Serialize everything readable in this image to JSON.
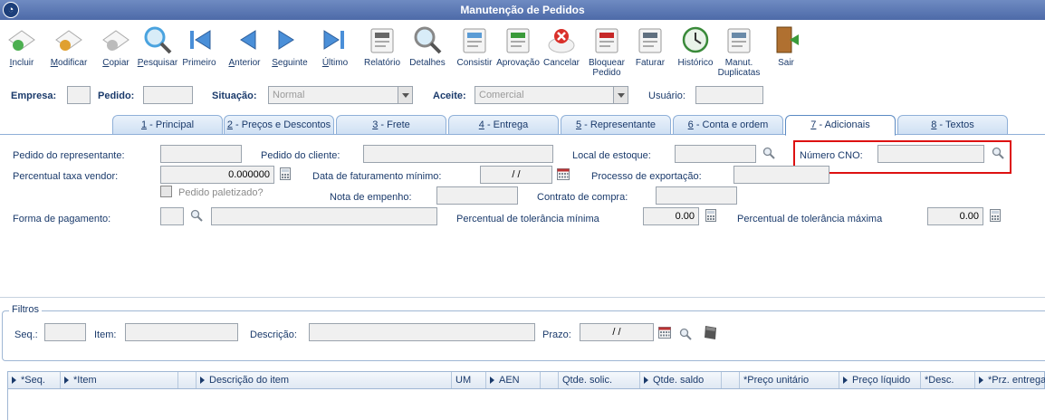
{
  "window": {
    "title": "Manutenção de Pedidos"
  },
  "toolbar": [
    {
      "label": "Incluir",
      "accel": "I",
      "rest": "ncluir",
      "icon": "add-document-icon"
    },
    {
      "label": "Modificar",
      "accel": "M",
      "rest": "odificar",
      "icon": "edit-document-icon"
    },
    {
      "label": "Copiar",
      "accel": "C",
      "rest": "opiar",
      "icon": "copy-icon"
    },
    {
      "label": "Pesquisar",
      "accel": "P",
      "rest": "esquisar",
      "icon": "magnifier-icon"
    },
    {
      "label": "Primeiro",
      "icon": "first-arrow-icon"
    },
    {
      "label": "Anterior",
      "accel": "A",
      "rest": "nterior",
      "icon": "previous-arrow-icon"
    },
    {
      "label": "Seguinte",
      "accel": "S",
      "rest": "eguinte",
      "icon": "next-arrow-icon"
    },
    {
      "label": "Último",
      "accel": "Ú",
      "rest": "ltimo",
      "icon": "last-arrow-icon"
    },
    {
      "label": "Relatório",
      "icon": "printer-icon"
    },
    {
      "label": "Detalhes",
      "icon": "details-magnifier-icon"
    },
    {
      "label": "Consistir",
      "icon": "consistency-check-icon"
    },
    {
      "label": "Aprovação",
      "icon": "approval-icon"
    },
    {
      "label": "Cancelar",
      "icon": "cancel-icon"
    },
    {
      "label": "Bloquear Pedido",
      "line1": "Bloquear",
      "line2": "Pedido",
      "icon": "block-order-icon"
    },
    {
      "label": "Faturar",
      "icon": "invoice-icon"
    },
    {
      "label": "Histórico",
      "icon": "history-icon"
    },
    {
      "label": "Manut. Duplicatas",
      "line1": "Manut.",
      "line2": "Duplicatas",
      "icon": "duplicates-icon"
    },
    {
      "label": "Sair",
      "icon": "exit-door-icon"
    }
  ],
  "header": {
    "empresa_label": "Empresa:",
    "empresa_value": "",
    "pedido_label": "Pedido:",
    "pedido_value": "",
    "situacao_label": "Situação:",
    "situacao_value": "Normal",
    "aceite_label": "Aceite:",
    "aceite_value": "Comercial",
    "usuario_label": "Usuário:",
    "usuario_value": ""
  },
  "tabs": [
    {
      "num": "1",
      "text": " - Principal"
    },
    {
      "num": "2",
      "text": " - Preços e Descontos"
    },
    {
      "num": "3",
      "text": " - Frete"
    },
    {
      "num": "4",
      "text": " - Entrega"
    },
    {
      "num": "5",
      "text": " - Representante"
    },
    {
      "num": "6",
      "text": " - Conta e ordem"
    },
    {
      "num": "7",
      "text": " - Adicionais",
      "active": true
    },
    {
      "num": "8",
      "text": " - Textos"
    }
  ],
  "form": {
    "pedido_representante_label": "Pedido do representante:",
    "pedido_cliente_label": "Pedido do cliente:",
    "local_estoque_label": "Local de estoque:",
    "numero_cno_label": "Número CNO:",
    "percentual_taxa_label": "Percentual taxa vendor:",
    "percentual_taxa_value": "0.000000",
    "data_faturamento_label": "Data de faturamento mínimo:",
    "data_faturamento_value": " / /",
    "processo_exportacao_label": "Processo de exportação:",
    "pedido_paletizado_label": "Pedido paletizado?",
    "nota_empenho_label": "Nota de empenho:",
    "contrato_compra_label": "Contrato de compra:",
    "forma_pagamento_label": "Forma de pagamento:",
    "tolerancia_minima_label": "Percentual de tolerância mínima",
    "tolerancia_minima_value": "0.00",
    "tolerancia_maxima_label": "Percentual de tolerância máxima",
    "tolerancia_maxima_value": "0.00"
  },
  "filtros": {
    "title": "Filtros",
    "seq_label": "Seq.:",
    "item_label": "Item:",
    "descricao_label": "Descrição:",
    "prazo_label": "Prazo:",
    "prazo_value": " / /"
  },
  "grid": {
    "columns": [
      "*Seq.",
      "*Item",
      "",
      "Descrição do item",
      "UM",
      "AEN",
      "",
      "Qtde. solic.",
      "Qtde. saldo",
      "",
      "*Preço unitário",
      "Preço líquido",
      "*Desc.",
      "*Prz. entrega"
    ]
  },
  "colors": {
    "title_bar": "#5a77b3",
    "highlight": "#dd1111",
    "label": "#1a3a6b"
  }
}
